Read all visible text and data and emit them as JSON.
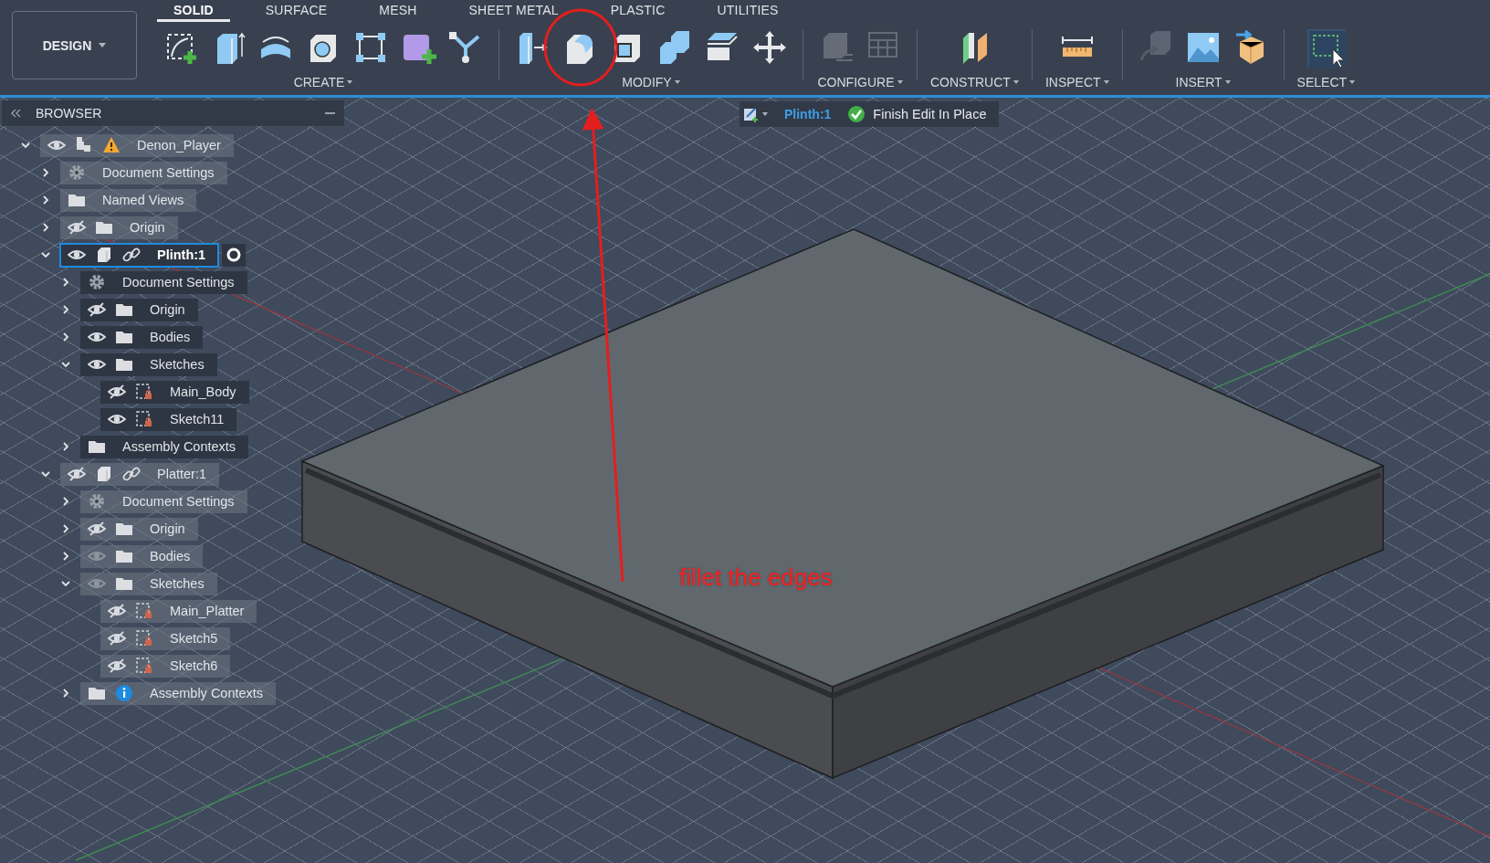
{
  "toolbar": {
    "workspace": {
      "label": "DESIGN"
    },
    "tabs": [
      {
        "label": "SOLID",
        "selected": true
      },
      {
        "label": "SURFACE",
        "selected": false
      },
      {
        "label": "MESH",
        "selected": false
      },
      {
        "label": "SHEET METAL",
        "selected": false
      },
      {
        "label": "PLASTIC",
        "selected": false
      },
      {
        "label": "UTILITIES",
        "selected": false
      }
    ],
    "groups": [
      {
        "label": "CREATE",
        "tools": [
          {
            "kind": "sketch",
            "disabled": false
          },
          {
            "kind": "extrude",
            "disabled": false
          },
          {
            "kind": "revolve",
            "disabled": false
          },
          {
            "kind": "hole",
            "disabled": false
          },
          {
            "kind": "pattern",
            "disabled": false
          },
          {
            "kind": "component",
            "disabled": false
          },
          {
            "kind": "automate",
            "disabled": false
          }
        ]
      },
      {
        "label": "MODIFY",
        "tools": [
          {
            "kind": "presspull",
            "disabled": false
          },
          {
            "kind": "fillet",
            "disabled": false
          },
          {
            "kind": "shell",
            "disabled": false
          },
          {
            "kind": "combine",
            "disabled": false
          },
          {
            "kind": "offset",
            "disabled": false
          },
          {
            "kind": "move",
            "disabled": false
          }
        ]
      },
      {
        "label": "CONFIGURE",
        "tools": [
          {
            "kind": "configure",
            "disabled": true
          },
          {
            "kind": "table",
            "disabled": true
          }
        ]
      },
      {
        "label": "CONSTRUCT",
        "tools": [
          {
            "kind": "plane",
            "disabled": false
          }
        ]
      },
      {
        "label": "INSPECT",
        "tools": [
          {
            "kind": "measure",
            "disabled": false
          }
        ]
      },
      {
        "label": "INSERT",
        "tools": [
          {
            "kind": "derive",
            "disabled": true
          },
          {
            "kind": "canvas",
            "disabled": false
          },
          {
            "kind": "mesh",
            "disabled": false
          }
        ]
      },
      {
        "label": "SELECT",
        "tools": [
          {
            "kind": "select",
            "disabled": false
          }
        ]
      }
    ]
  },
  "edit_bar": {
    "component": "Plinth:1",
    "finish": "Finish Edit In Place"
  },
  "browser": {
    "title": "BROWSER",
    "tree": [
      {
        "label": "Denon_Player",
        "kind": "document",
        "visible": true,
        "expanded": true,
        "warning": true,
        "active": false,
        "selected": false,
        "children": [
          {
            "label": "Document Settings",
            "kind": "settings",
            "expanded": false,
            "active": false,
            "selected": false
          },
          {
            "label": "Named Views",
            "kind": "folder",
            "expanded": false,
            "active": false,
            "selected": false
          },
          {
            "label": "Origin",
            "kind": "folder",
            "visible": false,
            "expanded": false,
            "active": false,
            "selected": false
          },
          {
            "label": "Plinth:1",
            "kind": "component",
            "visible": true,
            "expanded": true,
            "link": true,
            "active": true,
            "selected": true,
            "children": [
              {
                "label": "Document Settings",
                "kind": "settings",
                "expanded": false,
                "active": true,
                "selected": false
              },
              {
                "label": "Origin",
                "kind": "folder",
                "visible": false,
                "expanded": false,
                "active": true,
                "selected": false
              },
              {
                "label": "Bodies",
                "kind": "folder",
                "visible": true,
                "expanded": false,
                "active": true,
                "selected": false
              },
              {
                "label": "Sketches",
                "kind": "folder",
                "visible": true,
                "expanded": true,
                "active": true,
                "selected": false,
                "children": [
                  {
                    "label": "Main_Body",
                    "kind": "sketch",
                    "visible": false,
                    "active": true,
                    "selected": false
                  },
                  {
                    "label": "Sketch11",
                    "kind": "sketch",
                    "visible": true,
                    "active": true,
                    "selected": false
                  }
                ]
              },
              {
                "label": "Assembly Contexts",
                "kind": "folder",
                "expanded": false,
                "active": true,
                "selected": false
              }
            ]
          },
          {
            "label": "Platter:1",
            "kind": "component",
            "visible": false,
            "expanded": true,
            "link": true,
            "active": false,
            "selected": false,
            "children": [
              {
                "label": "Document Settings",
                "kind": "settings",
                "expanded": false,
                "active": false,
                "selected": false
              },
              {
                "label": "Origin",
                "kind": "folder",
                "visible": false,
                "expanded": false,
                "active": false,
                "selected": false
              },
              {
                "label": "Bodies",
                "kind": "folder",
                "visible": true,
                "expanded": false,
                "active": false,
                "selected": false
              },
              {
                "label": "Sketches",
                "kind": "folder",
                "visible": true,
                "expanded": true,
                "active": false,
                "selected": false,
                "children": [
                  {
                    "label": "Main_Platter",
                    "kind": "sketch",
                    "visible": false,
                    "active": false,
                    "selected": false
                  },
                  {
                    "label": "Sketch5",
                    "kind": "sketch",
                    "visible": false,
                    "active": false,
                    "selected": false
                  },
                  {
                    "label": "Sketch6",
                    "kind": "sketch",
                    "visible": false,
                    "active": false,
                    "selected": false
                  }
                ]
              },
              {
                "label": "Assembly Contexts",
                "kind": "folder",
                "expanded": false,
                "info": true,
                "active": false,
                "selected": false
              }
            ]
          }
        ]
      }
    ]
  },
  "annotation": {
    "text": "fillet the edges"
  }
}
